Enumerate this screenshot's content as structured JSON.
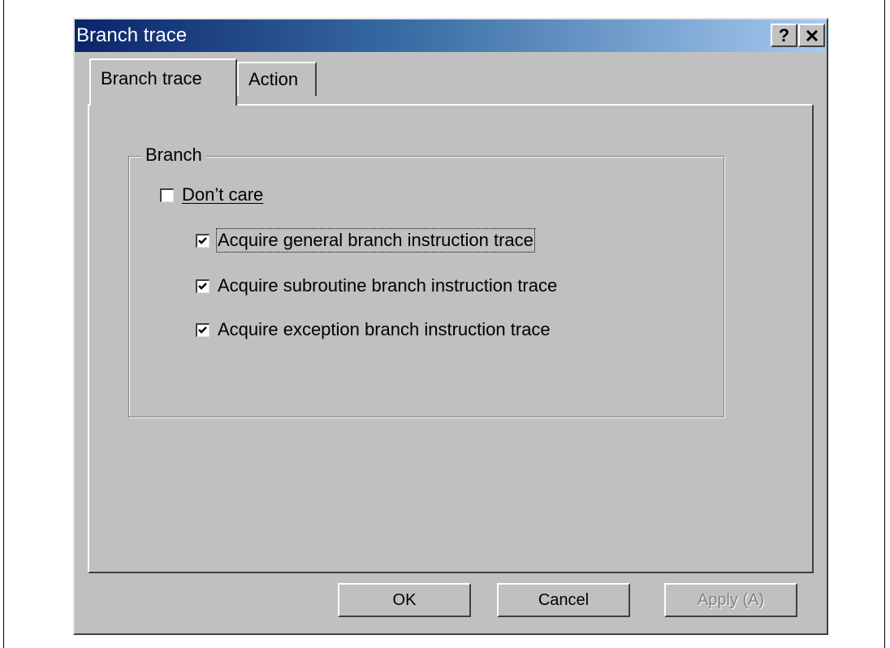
{
  "window": {
    "title": "Branch trace",
    "help_label": "?",
    "close_label": "×"
  },
  "tabs": [
    {
      "label": "Branch trace",
      "active": true
    },
    {
      "label": "Action",
      "active": false
    }
  ],
  "branch_group": {
    "label": "Branch",
    "dont_care": {
      "label": "Don’t care",
      "checked": false
    },
    "options": [
      {
        "label": "Acquire general branch instruction trace",
        "checked": true
      },
      {
        "label": "Acquire subroutine branch instruction trace",
        "checked": true
      },
      {
        "label": "Acquire exception branch instruction trace",
        "checked": true
      }
    ]
  },
  "buttons": {
    "ok": "OK",
    "cancel": "Cancel",
    "apply": "Apply (A)"
  }
}
